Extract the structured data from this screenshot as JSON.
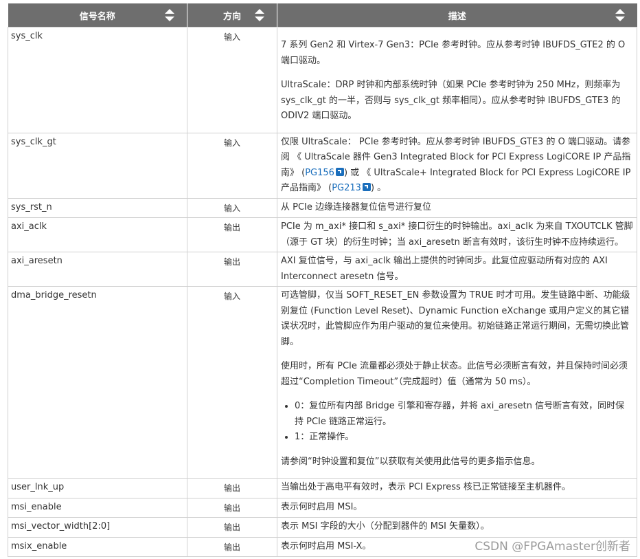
{
  "table": {
    "headers": {
      "name": "信号名称",
      "direction": "方向",
      "description": "描述"
    },
    "rows": [
      {
        "name": "sys_clk",
        "direction": "输入",
        "paragraphs": [
          "7 系列 Gen2 和 Virtex-7 Gen3：PCIe 参考时钟。应从参考时钟 IBUFDS_GTE2 的 O 端口驱动。",
          "UltraScale：DRP 时钟和内部系统时钟（如果 PCIe 参考时钟为 250 MHz，则频率为 sys_clk_gt 的一半，否则与 sys_clk_gt 频率相同）。应从参考时钟 IBUFDS_GTE3 的 ODIV2 端口驱动。"
        ]
      },
      {
        "name": "sys_clk_gt",
        "direction": "输入",
        "desc_parts": {
          "t1": "仅限 UltraScale： PCIe 参考时钟。应从参考时钟 IBUFDS_GTE3 的 O 端口驱动。请参阅 《 UltraScale 器件 Gen3 Integrated Block for PCI Express LogiCORE IP 产品指南》 (",
          "link1": "PG156",
          "t2": ") 或 《 UltraScale+ Integrated Block for PCI Express LogiCORE IP 产品指南》 (",
          "link2": "PG213",
          "t3": ") 。"
        }
      },
      {
        "name": "sys_rst_n",
        "direction": "输入",
        "description": "从 PCIe 边缘连接器复位信号进行复位"
      },
      {
        "name": "axi_aclk",
        "direction": "输出",
        "description": "PCIe 为 m_axi* 接口和 s_axi* 接口衍生的时钟输出。axi_aclk 为来自 TXOUTCLK 管脚（源于 GT 块）的衍生时钟；当 axi_aresetn 断言有效时，该衍生时钟不应持续运行。"
      },
      {
        "name": "axi_aresetn",
        "direction": "输出",
        "description": "AXI 复位信号，与 axi_aclk 输出上提供的时钟同步。此复位应驱动所有对应的 AXI Interconnect aresetn 信号。"
      },
      {
        "name": "dma_bridge_resetn",
        "direction": "输入",
        "paragraphs": [
          "可选管脚，仅当 SOFT_RESET_EN 参数设置为 TRUE 时才可用。发生链路中断、功能级别复位 (Function Level Reset)、Dynamic Function eXchange 或用户定义的其它错误状况时，此管脚应作为用户驱动的复位来使用。初始链路正常运行期间，无需切换此管脚。",
          "使用时，所有 PCIe 流量都必须处于静止状态。此信号必须断言有效，并且保持时间必须超过“Completion Timeout”（完成超时）值（通常为 50 ms）。"
        ],
        "bullets": [
          "0：复位所有内部 Bridge 引擎和寄存器，并将 axi_aresetn 信号断言有效，同时保持 PCIe 链路正常运行。",
          "1：正常操作。"
        ],
        "footer": "请参阅“时钟设置和复位”以获取有关使用此信号的更多指示信息。"
      },
      {
        "name": "user_lnk_up",
        "direction": "输出",
        "description": "当输出处于高电平有效时，表示 PCI Express 核已正常链接至主机器件。"
      },
      {
        "name": "msi_enable",
        "direction": "输出",
        "description": "表示何时启用 MSI。"
      },
      {
        "name": "msi_vector_width[2:0]",
        "direction": "输出",
        "description": "表示 MSI 字段的大小（分配到器件的 MSI 矢量数）。"
      },
      {
        "name": "msix_enable",
        "direction": "输出",
        "description": "表示何时启用 MSI-X。"
      }
    ]
  },
  "watermark": "CSDN @FPGAmaster创新者"
}
